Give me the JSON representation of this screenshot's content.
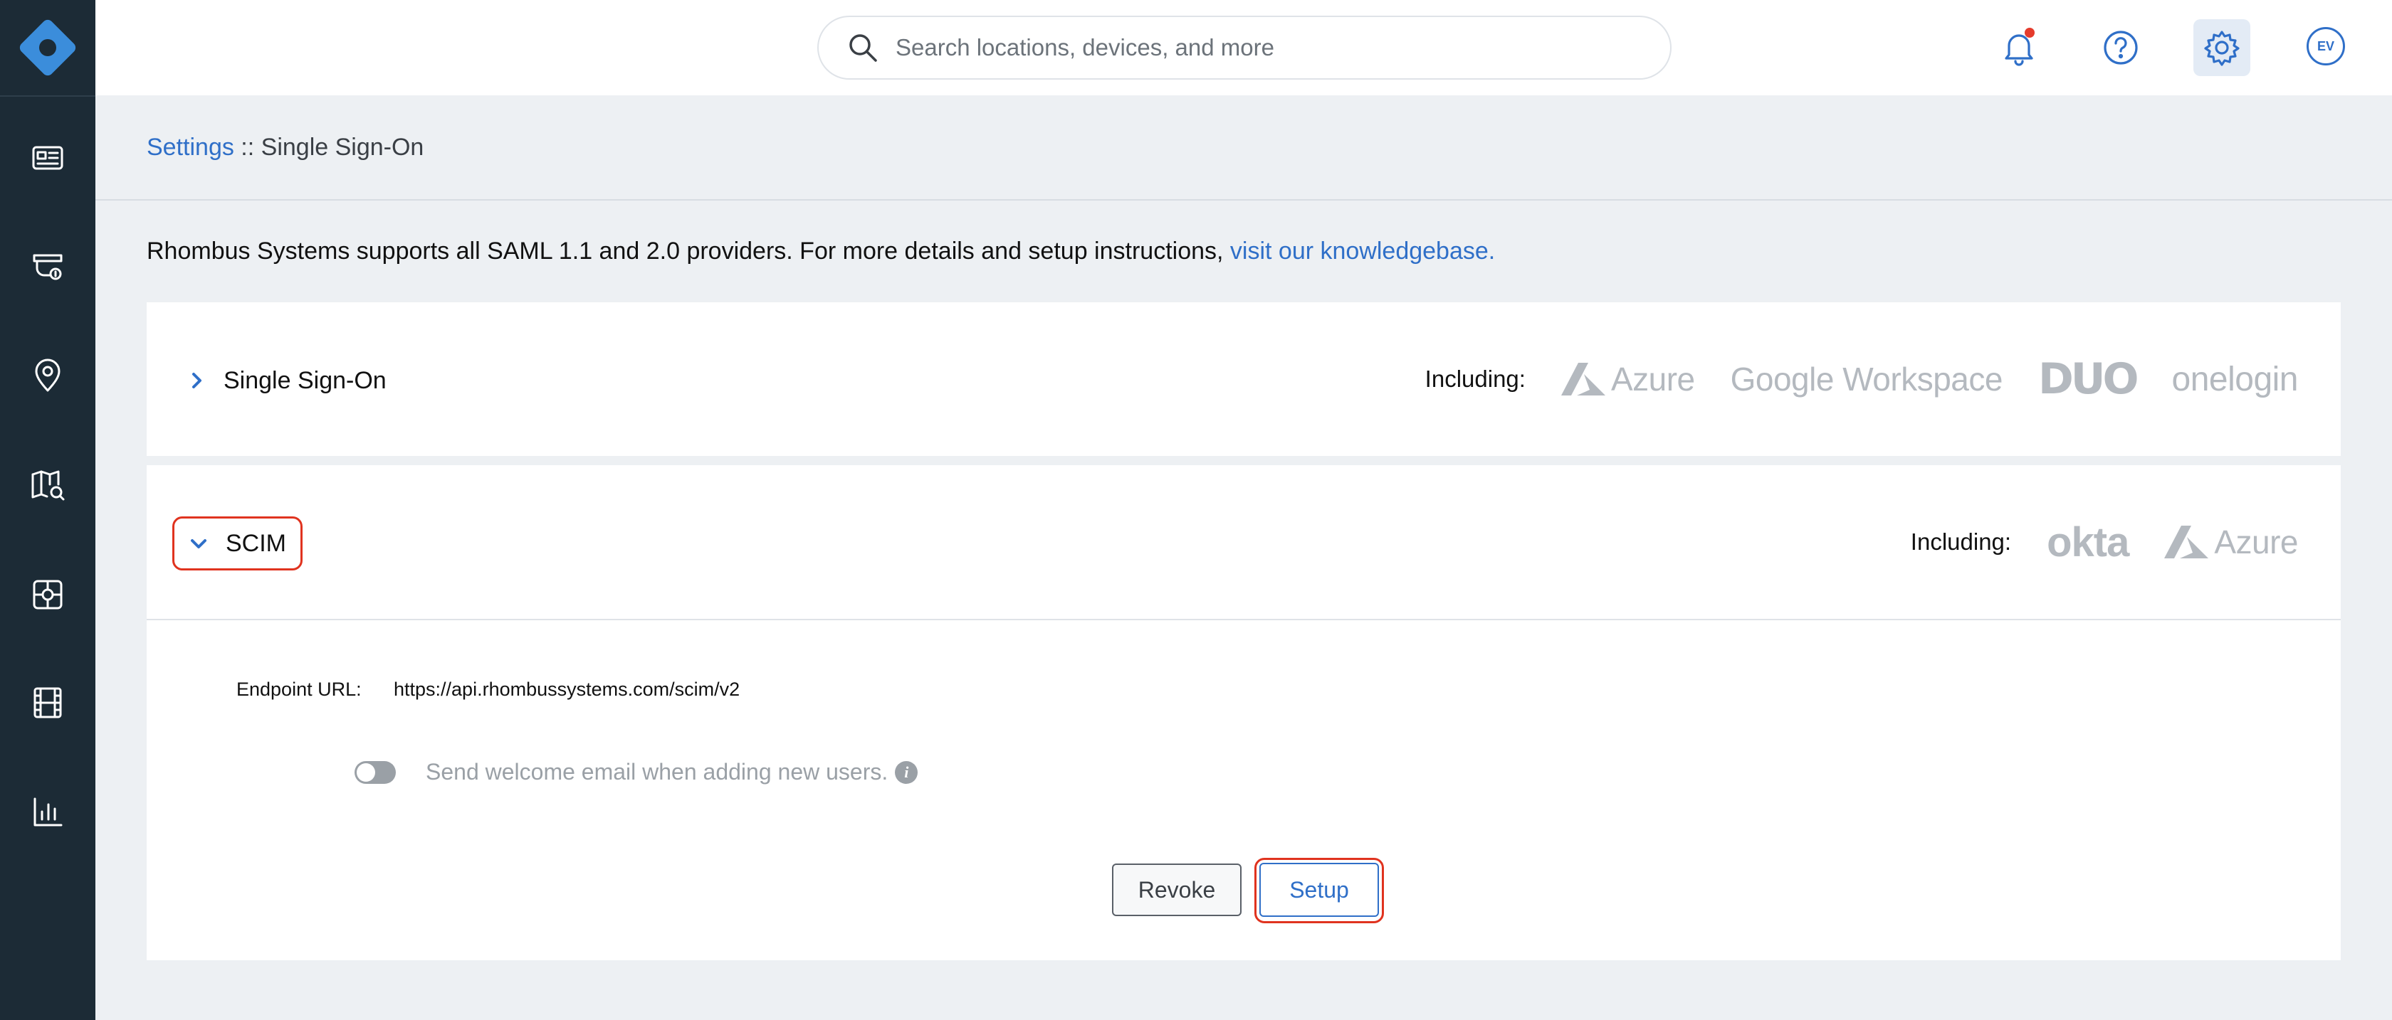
{
  "sidebar": {
    "items": [
      {
        "name": "dashboard-icon"
      },
      {
        "name": "camera-icon"
      },
      {
        "name": "location-pin-icon"
      },
      {
        "name": "map-search-icon"
      },
      {
        "name": "access-control-icon"
      },
      {
        "name": "video-film-icon"
      },
      {
        "name": "analytics-chart-icon"
      }
    ]
  },
  "header": {
    "search_placeholder": "Search locations, devices, and more",
    "avatar_initials": "EV",
    "accent_color": "#2f6fc8",
    "notification_color": "#e53b2c"
  },
  "breadcrumb": {
    "parent": "Settings",
    "separator": " :: ",
    "current": "Single Sign-On"
  },
  "info": {
    "text": "Rhombus Systems supports all SAML 1.1 and 2.0 providers. For more details and setup instructions, ",
    "link": "visit our knowledgebase."
  },
  "sso_panel": {
    "title": "Single Sign-On",
    "including_label": "Including:",
    "brands": [
      "Azure",
      "Google Workspace",
      "DUO",
      "onelogin"
    ]
  },
  "scim_panel": {
    "title": "SCIM",
    "including_label": "Including:",
    "brands": [
      "okta",
      "Azure"
    ],
    "endpoint_label": "Endpoint URL:",
    "endpoint_value": "https://api.rhombussystems.com/scim/v2",
    "welcome_text": "Send welcome email when adding new users.",
    "welcome_enabled": false,
    "revoke_label": "Revoke",
    "setup_label": "Setup"
  }
}
